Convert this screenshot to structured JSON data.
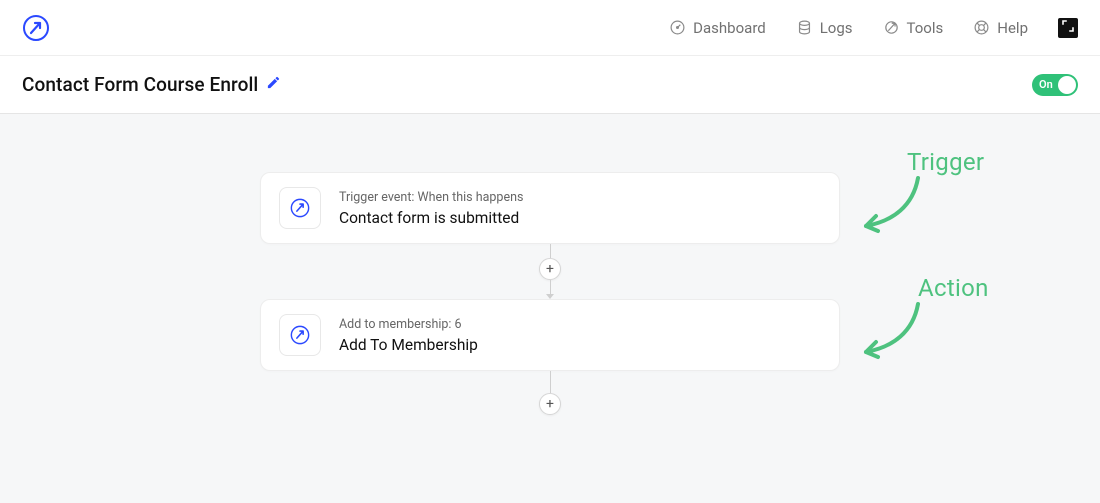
{
  "nav": {
    "dashboard": "Dashboard",
    "logs": "Logs",
    "tools": "Tools",
    "help": "Help"
  },
  "page": {
    "title": "Contact Form Course Enroll",
    "toggle_label": "On"
  },
  "flow": {
    "trigger": {
      "supertitle": "Trigger event: When this happens",
      "title": "Contact form is submitted"
    },
    "action": {
      "supertitle": "Add to membership: 6",
      "title": "Add To Membership"
    }
  },
  "annotations": {
    "trigger": "Trigger",
    "action": "Action"
  }
}
